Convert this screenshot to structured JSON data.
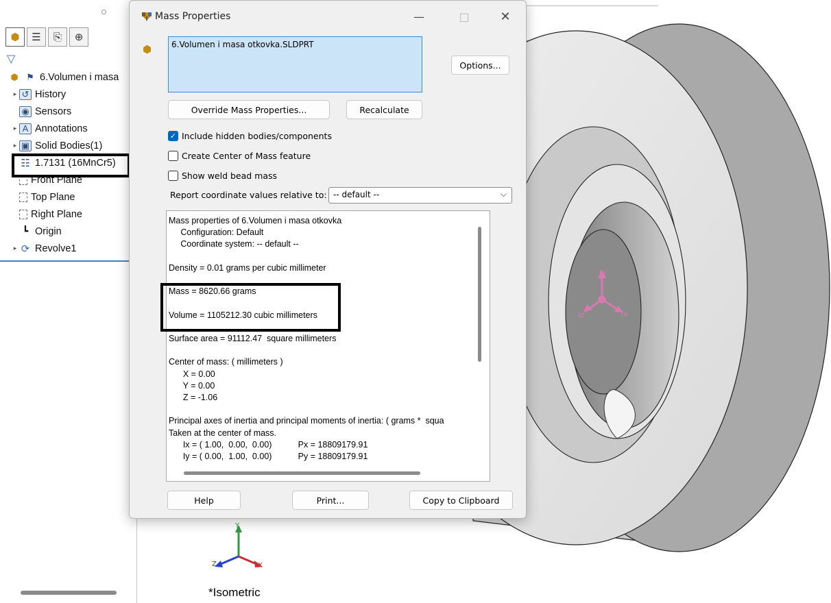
{
  "feature_tree": {
    "tabs": [
      "feature-manager",
      "property-manager",
      "configuration-manager",
      "dimxpert-manager"
    ],
    "items": [
      {
        "label": "6.Volumen i masa",
        "icon": "part-icon",
        "expandable": false
      },
      {
        "label": "History",
        "icon": "history-folder-icon",
        "expandable": true
      },
      {
        "label": "Sensors",
        "icon": "sensors-icon",
        "expandable": false
      },
      {
        "label": "Annotations",
        "icon": "annotations-icon",
        "expandable": true
      },
      {
        "label": "Solid Bodies(1)",
        "icon": "solid-bodies-icon",
        "expandable": true
      },
      {
        "label": "1.7131 (16MnCr5)",
        "icon": "material-icon",
        "expandable": false
      },
      {
        "label": "Front Plane",
        "icon": "plane-icon",
        "expandable": false
      },
      {
        "label": "Top Plane",
        "icon": "plane-icon",
        "expandable": false
      },
      {
        "label": "Right Plane",
        "icon": "plane-icon",
        "expandable": false
      },
      {
        "label": "Origin",
        "icon": "origin-icon",
        "expandable": false
      },
      {
        "label": "Revolve1",
        "icon": "revolve-icon",
        "expandable": true
      }
    ]
  },
  "viewport": {
    "view_label": "*Isometric",
    "triad": {
      "x": "X",
      "y": "Y",
      "z": "Z"
    },
    "model_triad": {
      "ix": "Ix",
      "iy": "Iy",
      "iz": "Iz"
    }
  },
  "dialog": {
    "title": "Mass Properties",
    "selected_file": "6.Volumen i masa otkovka.SLDPRT",
    "buttons": {
      "options": "Options...",
      "override": "Override Mass Properties...",
      "recalculate": "Recalculate",
      "help": "Help",
      "print": "Print...",
      "copy": "Copy to Clipboard"
    },
    "checkboxes": [
      {
        "label": "Include hidden bodies/components",
        "checked": true
      },
      {
        "label": "Create Center of Mass feature",
        "checked": false
      },
      {
        "label": "Show weld bead mass",
        "checked": false
      }
    ],
    "report_label": "Report coordinate values relative to:",
    "report_value": "-- default --",
    "results_lines": [
      "Mass properties of 6.Volumen i masa otkovka",
      "     Configuration: Default",
      "     Coordinate system: -- default --",
      "",
      "Density = 0.01 grams per cubic millimeter",
      "",
      "Mass = 8620.66 grams",
      "",
      "Volume = 1105212.30 cubic millimeters",
      "",
      "Surface area = 91112.47  square millimeters",
      "",
      "Center of mass: ( millimeters )",
      "      X = 0.00",
      "      Y = 0.00",
      "      Z = -1.06",
      "",
      "Principal axes of inertia and principal moments of inertia: ( grams *  squa",
      "Taken at the center of mass.",
      "      Ix = ( 1.00,  0.00,  0.00)           Px = 18809179.91",
      "      Iy = ( 0.00,  1.00,  0.00)           Py = 18809179.91"
    ]
  },
  "colors": {
    "selection_bg": "#cce4f7",
    "accent": "#0067c0",
    "tree_separator": "#3b82c4"
  }
}
